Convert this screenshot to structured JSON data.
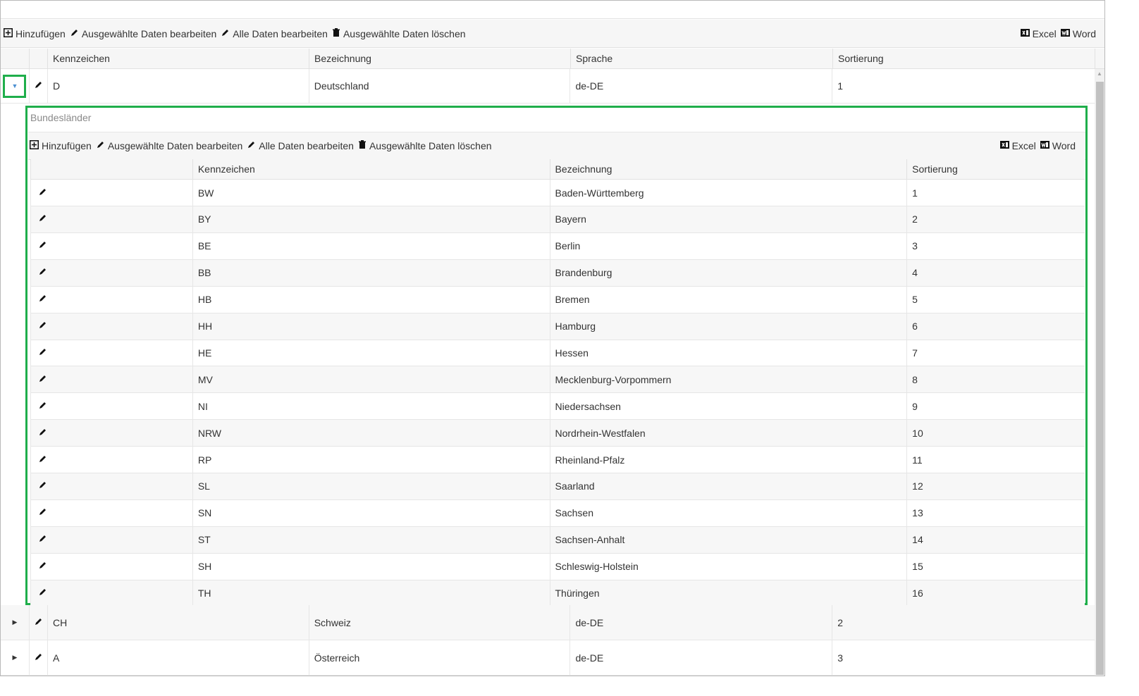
{
  "toolbar": {
    "add": "Hinzufügen",
    "edit_selected": "Ausgewählte Daten bearbeiten",
    "edit_all": "Alle Daten bearbeiten",
    "delete_selected": "Ausgewählte Daten löschen",
    "excel": "Excel",
    "word": "Word"
  },
  "main_grid": {
    "columns": [
      "Kennzeichen",
      "Bezeichnung",
      "Sprache",
      "Sortierung"
    ],
    "rows": [
      {
        "kennzeichen": "D",
        "bezeichnung": "Deutschland",
        "sprache": "de-DE",
        "sortierung": "1",
        "expanded": true
      },
      {
        "kennzeichen": "CH",
        "bezeichnung": "Schweiz",
        "sprache": "de-DE",
        "sortierung": "2",
        "expanded": false
      },
      {
        "kennzeichen": "A",
        "bezeichnung": "Österreich",
        "sprache": "de-DE",
        "sortierung": "3",
        "expanded": false
      }
    ]
  },
  "detail": {
    "title": "Bundesländer",
    "columns": [
      "Kennzeichen",
      "Bezeichnung",
      "Sortierung"
    ],
    "rows": [
      [
        "BW",
        "Baden-Württemberg",
        "1"
      ],
      [
        "BY",
        "Bayern",
        "2"
      ],
      [
        "BE",
        "Berlin",
        "3"
      ],
      [
        "BB",
        "Brandenburg",
        "4"
      ],
      [
        "HB",
        "Bremen",
        "5"
      ],
      [
        "HH",
        "Hamburg",
        "6"
      ],
      [
        "HE",
        "Hessen",
        "7"
      ],
      [
        "MV",
        "Mecklenburg-Vorpommern",
        "8"
      ],
      [
        "NI",
        "Niedersachsen",
        "9"
      ],
      [
        "NRW",
        "Nordrhein-Westfalen",
        "10"
      ],
      [
        "RP",
        "Rheinland-Pfalz",
        "11"
      ],
      [
        "SL",
        "Saarland",
        "12"
      ],
      [
        "SN",
        "Sachsen",
        "13"
      ],
      [
        "ST",
        "Sachsen-Anhalt",
        "14"
      ],
      [
        "SH",
        "Schleswig-Holstein",
        "15"
      ],
      [
        "TH",
        "Thüringen",
        "16"
      ]
    ]
  },
  "icons": {
    "add": "plus-square-icon",
    "edit": "pencil-icon",
    "delete": "trash-icon",
    "excel": "excel-icon",
    "word": "word-icon",
    "expanded": "triangle-down-icon",
    "collapsed": "triangle-right-icon"
  },
  "colors": {
    "highlight": "#1fae4b",
    "expander_arrow": "#4b8fd1",
    "header_bg": "#f6f6f6"
  }
}
